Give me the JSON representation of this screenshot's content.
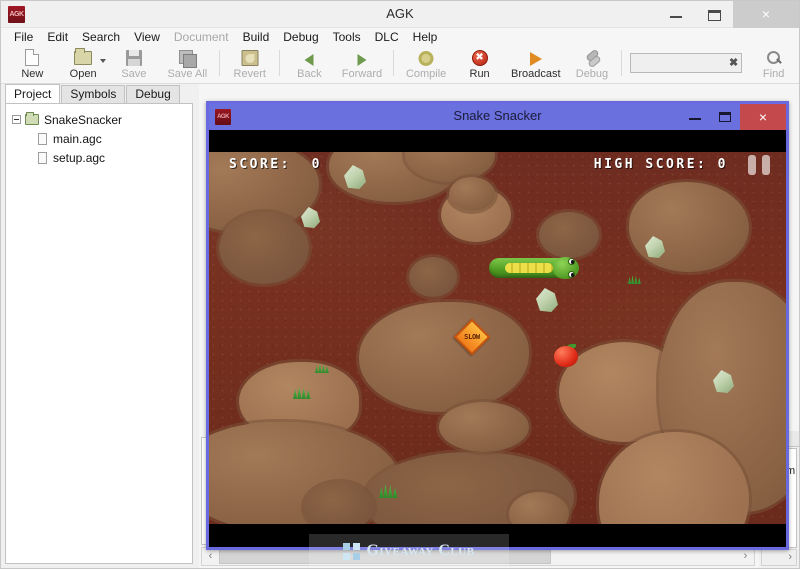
{
  "window": {
    "title": "AGK",
    "icon_label": "AGK",
    "controls": {
      "minimize": "minimize-window",
      "maximize": "maximize-window",
      "close": "×"
    }
  },
  "menubar": {
    "items": [
      {
        "label": "File",
        "mnemonic": "F",
        "disabled": false
      },
      {
        "label": "Edit",
        "mnemonic": "E",
        "disabled": false
      },
      {
        "label": "Search",
        "mnemonic": "S",
        "disabled": false
      },
      {
        "label": "View",
        "mnemonic": "V",
        "disabled": false
      },
      {
        "label": "Document",
        "mnemonic": "D",
        "disabled": true
      },
      {
        "label": "Build",
        "mnemonic": "B",
        "disabled": false
      },
      {
        "label": "Debug",
        "mnemonic": "e",
        "disabled": false
      },
      {
        "label": "Tools",
        "mnemonic": "T",
        "disabled": false
      },
      {
        "label": "DLC",
        "mnemonic": "L",
        "disabled": false
      },
      {
        "label": "Help",
        "mnemonic": "H",
        "disabled": false
      }
    ]
  },
  "toolbar": {
    "buttons": [
      {
        "label": "New",
        "icon": "new-document-icon",
        "disabled": false,
        "dropdown": false
      },
      {
        "label": "Open",
        "icon": "open-folder-icon",
        "disabled": false,
        "dropdown": true
      },
      {
        "label": "Save",
        "icon": "save-disk-icon",
        "disabled": true,
        "dropdown": false
      },
      {
        "label": "Save All",
        "icon": "save-all-icon",
        "disabled": true,
        "dropdown": false
      },
      {
        "label": "Revert",
        "icon": "revert-icon",
        "disabled": true,
        "dropdown": false
      },
      {
        "label": "Back",
        "icon": "arrow-left-icon",
        "disabled": true,
        "dropdown": false
      },
      {
        "label": "Forward",
        "icon": "arrow-right-icon",
        "disabled": true,
        "dropdown": false
      },
      {
        "label": "Compile",
        "icon": "gear-icon",
        "disabled": true,
        "dropdown": false
      },
      {
        "label": "Run",
        "icon": "run-icon",
        "disabled": false,
        "dropdown": false
      },
      {
        "label": "Broadcast",
        "icon": "broadcast-play-icon",
        "disabled": false,
        "dropdown": false
      },
      {
        "label": "Debug",
        "icon": "debug-icon",
        "disabled": true,
        "dropdown": false
      },
      {
        "label": "Find",
        "icon": "search-magnifier-icon",
        "disabled": true,
        "dropdown": false
      }
    ],
    "search": {
      "value": "",
      "placeholder": "",
      "clear_glyph": "✖"
    }
  },
  "left_panel": {
    "tabs": [
      {
        "label": "Project",
        "active": true
      },
      {
        "label": "Symbols",
        "active": false
      },
      {
        "label": "Debug",
        "active": false
      }
    ],
    "tree": {
      "root": {
        "label": "SnakeSnacker",
        "expanded": true
      },
      "children": [
        {
          "label": "main.agc"
        },
        {
          "label": "setup.agc"
        }
      ]
    }
  },
  "right_panel": {
    "path_fragment": "\\Exam",
    "scroll_arrow": "›"
  },
  "bottom_scrollbar": {
    "left_arrow": "‹",
    "right_arrow": "›"
  },
  "game_window": {
    "title": "Snake Snacker",
    "icon_label": "AGK",
    "controls": {
      "minimize": "minimize",
      "maximize": "maximize",
      "close": "×"
    },
    "hud": {
      "score_label": "SCORE:",
      "score_value": "0",
      "high_score_label": "HIGH SCORE:",
      "high_score_value": "0",
      "pause_button": "pause"
    },
    "entities": {
      "snake": "snake-player",
      "apple": "apple-pickup",
      "powerup_label": "SLOW"
    },
    "colors": {
      "titlebar": "#6a70dd",
      "border": "#6a6ae0",
      "close_button": "#c4494c",
      "dirt": "#77301f",
      "rock": "#8a6244"
    }
  },
  "watermark": {
    "text": "Giveaway Club"
  }
}
